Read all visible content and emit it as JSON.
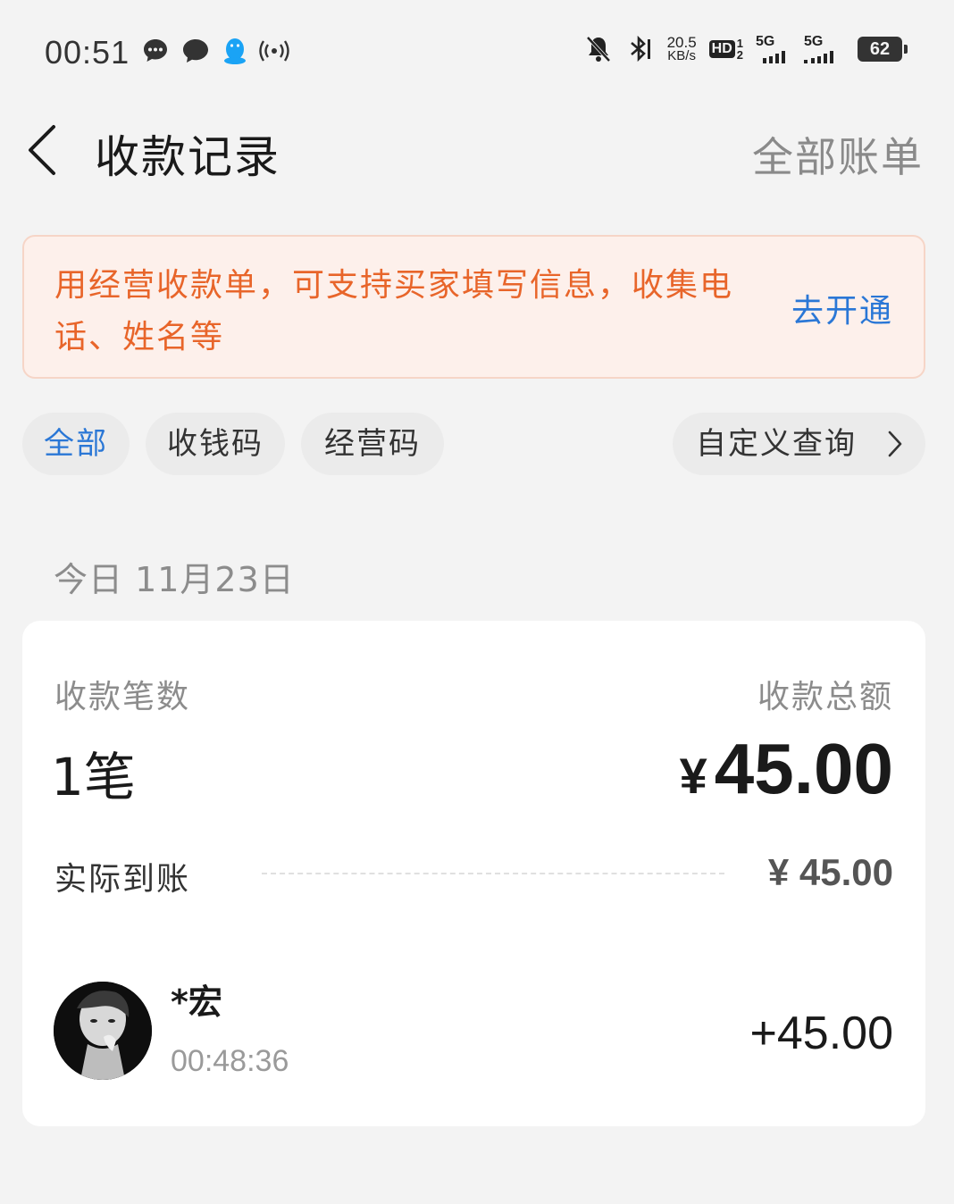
{
  "status_bar": {
    "time": "00:51",
    "net_speed_value": "20.5",
    "net_speed_unit": "KB/s",
    "hd_label": "HD",
    "hd_sim_top": "1",
    "hd_sim_bottom": "2",
    "sig1_label": "5G",
    "sig2_label": "5G",
    "battery": "62",
    "icons_left": [
      "chat-bubble-dots-icon",
      "chat-bubble-icon",
      "penguin-icon",
      "broadcast-icon"
    ],
    "icons_right": [
      "bell-muted-icon",
      "bluetooth-icon"
    ]
  },
  "header": {
    "title": "收款记录",
    "right_link": "全部账单"
  },
  "banner": {
    "text": "用经营收款单，可支持买家填写信息，收集电话、姓名等",
    "link": "去开通",
    "text_color": "#e8652a",
    "link_color": "#2a77d6"
  },
  "filters": {
    "chips": [
      "全部",
      "收钱码",
      "经营码"
    ],
    "active": "全部",
    "custom_query": "自定义查询"
  },
  "date_label": "今日 11月23日",
  "summary": {
    "count_label": "收款笔数",
    "total_label": "收款总额",
    "count_value": "1笔",
    "total_currency": "¥",
    "total_value": "45.00",
    "actual_label": "实际到账",
    "actual_value": "¥ 45.00"
  },
  "transactions": [
    {
      "name": "*宏",
      "time": "00:48:36",
      "amount": "+45.00"
    }
  ]
}
